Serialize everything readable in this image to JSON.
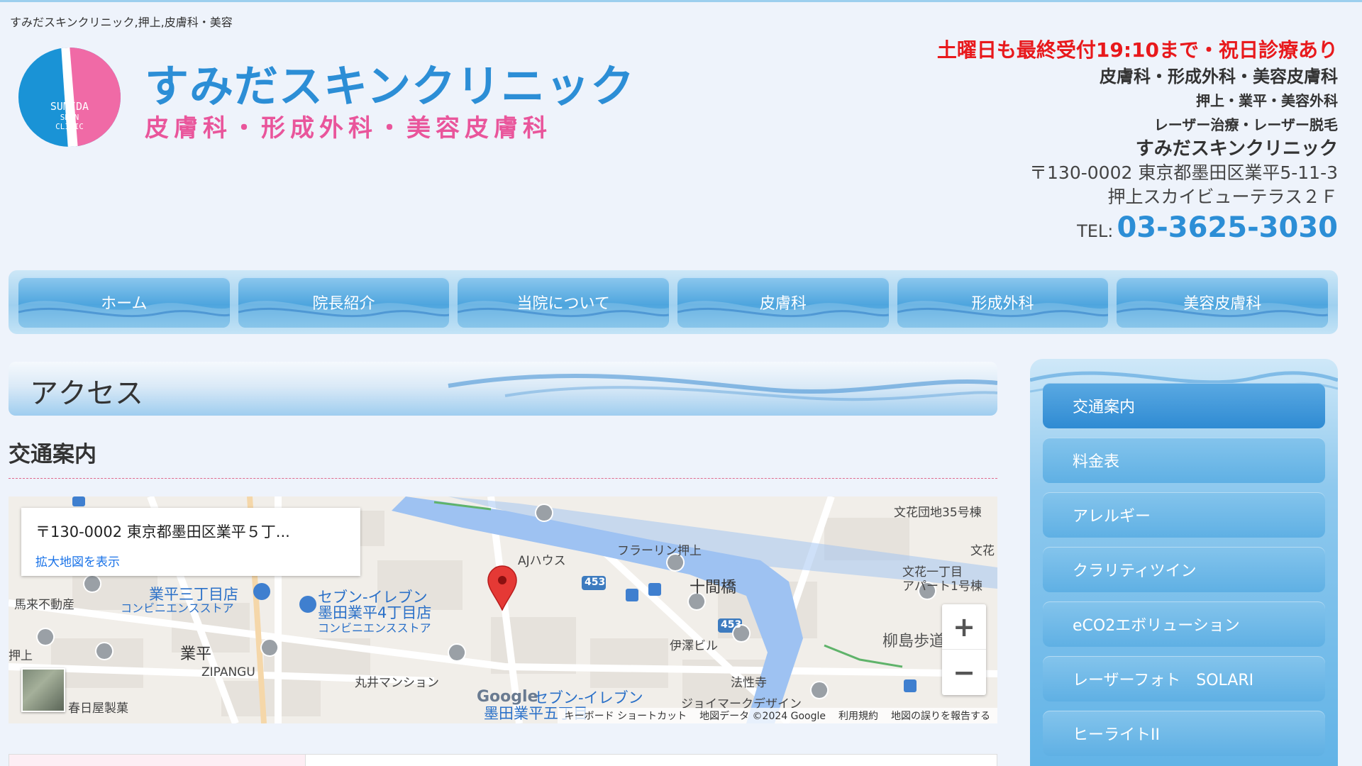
{
  "site": {
    "tagline": "すみだスキンクリニック,押上,皮膚科・美容",
    "logo_text": [
      "SUMIDA",
      "SKIN",
      "CLINIC"
    ],
    "brand_name": "すみだスキンクリニック",
    "brand_sub": "皮膚科・形成外科・美容皮膚科"
  },
  "header": {
    "notice": "土曜日も最終受付19:10まで・祝日診療あり",
    "line2": "皮膚科・形成外科・美容皮膚科",
    "line3": "押上・業平・美容外科",
    "line4": "レーザー治療・レーザー脱毛",
    "line5": "すみだスキンクリニック",
    "address1": "〒130-0002 東京都墨田区業平5-11-3",
    "address2": "押上スカイビューテラス２Ｆ",
    "tel_label": "TEL:",
    "tel": "03-3625-3030"
  },
  "nav": [
    "ホーム",
    "院長紹介",
    "当院について",
    "皮膚科",
    "形成外科",
    "美容皮膚科"
  ],
  "page": {
    "title": "アクセス",
    "section": "交通案内"
  },
  "map": {
    "card_address": "〒130-0002 東京都墨田区業平５丁...",
    "card_link": "拡大地図を表示",
    "labels": {
      "bunka35": "文花団地35号棟",
      "bunka_cut": "文花",
      "bunka1": "文花一丁目",
      "apart1": "アパート1号棟",
      "ajhouse": "AJハウス",
      "flarin": "フラーリン押上",
      "jukken": "十間橋",
      "road453a": "453",
      "road453b": "453",
      "gyohei3": "業平三丁目店",
      "conv1": "コンビニエンスストア",
      "seven": "セブン-イレブン",
      "seven2": "墨田業平4丁目店",
      "conv2": "コンビニエンスストア",
      "umaki": "馬来不動産",
      "oshiage": "押上",
      "gyohei": "業平",
      "zipangu": "ZIPANGU",
      "marui": "丸井マンション",
      "kasuga": "春日屋製菓",
      "izawa": "伊澤ビル",
      "hosho": "法性寺",
      "joymark": "ジョイマークデザイン",
      "yanagi": "柳島歩道",
      "seven3": "セブン-イレブン",
      "sumida": "墨田業平五丁目"
    },
    "google": "Google",
    "zoom_in": "+",
    "zoom_out": "−",
    "footer": {
      "shortcuts": "キーボード ショートカット",
      "data": "地図データ ©2024 Google",
      "terms": "利用規約",
      "report": "地図の誤りを報告する"
    }
  },
  "sidebar": [
    "交通案内",
    "料金表",
    "アレルギー",
    "クラリティツイン",
    "eCO2エボリューション",
    "レーザーフォト　SOLARI",
    "ヒーライトII"
  ],
  "colors": {
    "accent_blue": "#2c8ed6",
    "accent_pink": "#e9559b",
    "notice_red": "#e8191c"
  }
}
